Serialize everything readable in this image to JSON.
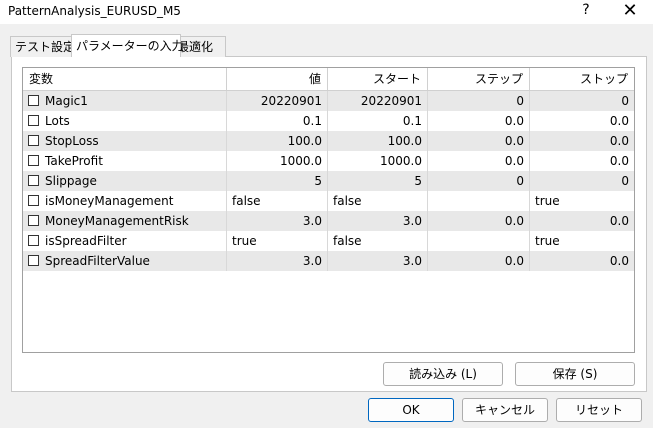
{
  "window": {
    "title": "PatternAnalysis_EURUSD_M5",
    "help_label": "?",
    "close_label": "✕"
  },
  "tabs": [
    {
      "label": "テスト設定",
      "active": false
    },
    {
      "label": "パラメーターの入力",
      "active": true
    },
    {
      "label": "最適化",
      "active": false
    }
  ],
  "table": {
    "columns": [
      "変数",
      "値",
      "スタート",
      "ステップ",
      "ストップ"
    ],
    "rows": [
      {
        "name": "Magic1",
        "value": "20220901",
        "start": "20220901",
        "step": "0",
        "stop": "0",
        "checked": false
      },
      {
        "name": "Lots",
        "value": "0.1",
        "start": "0.1",
        "step": "0.0",
        "stop": "0.0",
        "checked": false
      },
      {
        "name": "StopLoss",
        "value": "100.0",
        "start": "100.0",
        "step": "0.0",
        "stop": "0.0",
        "checked": false
      },
      {
        "name": "TakeProfit",
        "value": "1000.0",
        "start": "1000.0",
        "step": "0.0",
        "stop": "0.0",
        "checked": false
      },
      {
        "name": "Slippage",
        "value": "5",
        "start": "5",
        "step": "0",
        "stop": "0",
        "checked": false
      },
      {
        "name": "isMoneyManagement",
        "value": "false",
        "start": "false",
        "step": "",
        "stop": "true",
        "checked": false
      },
      {
        "name": "MoneyManagementRisk",
        "value": "3.0",
        "start": "3.0",
        "step": "0.0",
        "stop": "0.0",
        "checked": false
      },
      {
        "name": "isSpreadFilter",
        "value": "true",
        "start": "false",
        "step": "",
        "stop": "true",
        "checked": false
      },
      {
        "name": "SpreadFilterValue",
        "value": "3.0",
        "start": "3.0",
        "step": "0.0",
        "stop": "0.0",
        "checked": false
      }
    ]
  },
  "buttons": {
    "load": "読み込み (L)",
    "save": "保存 (S)",
    "ok": "OK",
    "cancel": "キャンセル",
    "reset": "リセット"
  },
  "colors": {
    "row_shade": "#e8e8e8",
    "accent": "#0067c0"
  }
}
